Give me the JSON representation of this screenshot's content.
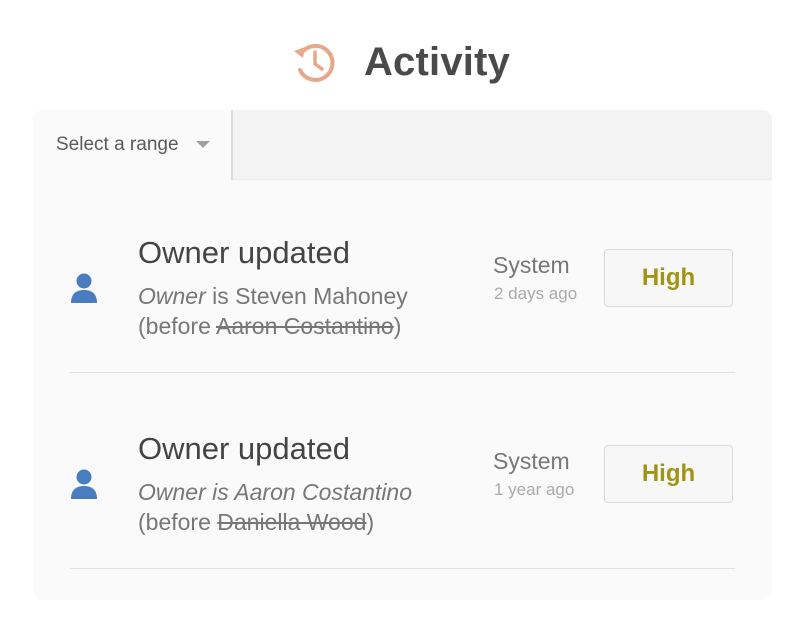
{
  "header": {
    "title": "Activity",
    "icon": "history-icon",
    "icon_color": "#e8a789"
  },
  "filter": {
    "range_label": "Select a range"
  },
  "entries": [
    {
      "title": "Owner updated",
      "field": "Owner",
      "is_word": " is ",
      "new_value": "Steven Mahoney",
      "before_prefix": "(before ",
      "old_value": "Aaron Costantino",
      "before_suffix": ")",
      "actor": "System",
      "time": "2 days ago",
      "priority": "High",
      "icon": "user-icon"
    },
    {
      "title": "Owner updated",
      "field": "Owner",
      "is_word": " is ",
      "new_value": "Aaron Costantino",
      "before_prefix": "(before ",
      "old_value": "Daniella Wood",
      "before_suffix": ")",
      "actor": "System",
      "time": "1 year ago",
      "priority": "High",
      "icon": "user-icon"
    }
  ],
  "colors": {
    "accent_icon": "#e8a789",
    "user_icon": "#4a7cc0",
    "priority_text": "#a09414"
  }
}
